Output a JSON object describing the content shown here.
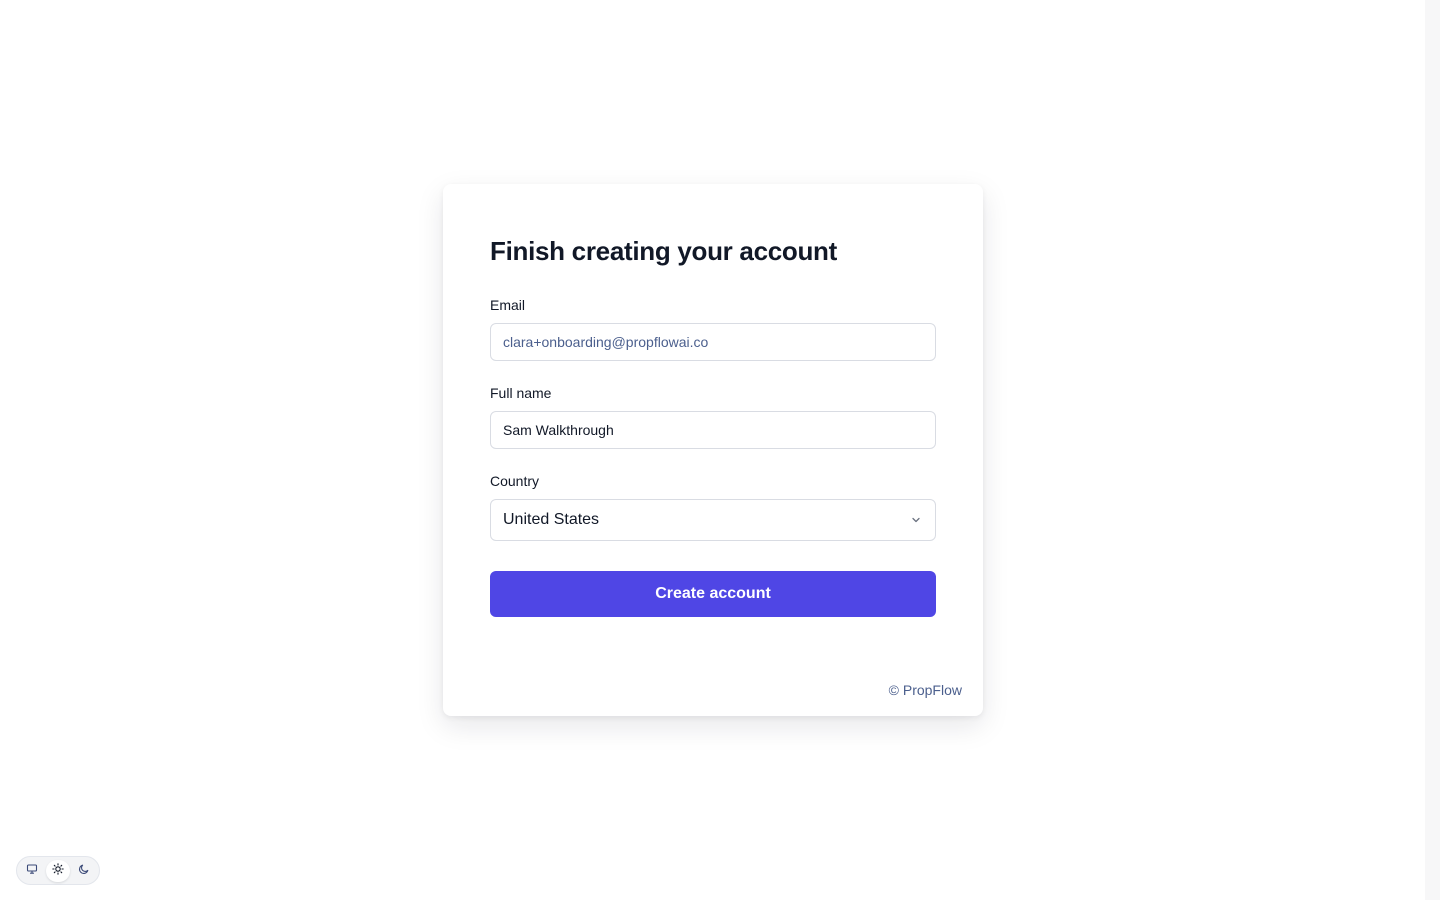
{
  "form": {
    "title": "Finish creating your account",
    "email": {
      "label": "Email",
      "value": "clara+onboarding@propflowai.co"
    },
    "full_name": {
      "label": "Full name",
      "value": "Sam Walkthrough"
    },
    "country": {
      "label": "Country",
      "selected": "United States",
      "icon": "chevron-down-icon"
    },
    "submit_label": "Create account"
  },
  "footer": {
    "copyright": "© PropFlow"
  },
  "theme_switcher": {
    "options": [
      "system",
      "light",
      "dark"
    ],
    "icons": [
      "monitor-icon",
      "sun-icon",
      "moon-icon"
    ],
    "active": "light"
  },
  "colors": {
    "accent": "#4f46e5",
    "muted_text": "#4b5f8d",
    "heading": "#111827",
    "border": "#d9dce3"
  }
}
